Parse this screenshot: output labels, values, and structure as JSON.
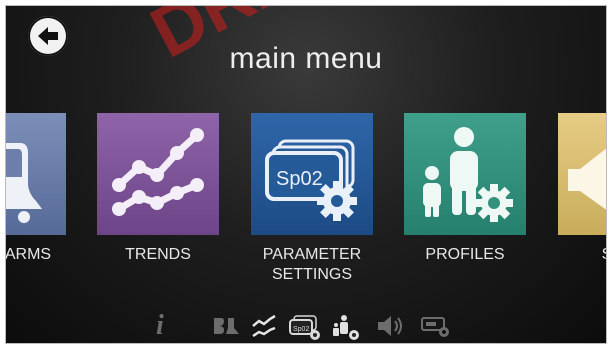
{
  "header": {
    "title": "main menu",
    "watermark": "DRAFT"
  },
  "tiles": [
    {
      "label": "ARMS",
      "icon": "alarm-bell-icon",
      "color": "#6c7fa9"
    },
    {
      "label": "TRENDS",
      "icon": "trends-graph-icon",
      "color": "#7e55a0"
    },
    {
      "label": "PARAMETER SETTINGS",
      "icon": "spo2-settings-icon",
      "color": "#255a99"
    },
    {
      "label": "PROFILES",
      "icon": "profiles-family-icon",
      "color": "#33917c"
    },
    {
      "label": "SOU",
      "icon": "speaker-icon",
      "color": "#d8bd70"
    }
  ],
  "bottom_bar": {
    "icons": [
      "info-icon",
      "alarm-silence-icon",
      "trends-icon",
      "parameter-settings-icon",
      "profiles-icon",
      "sound-icon",
      "device-settings-icon"
    ],
    "info_glyph": "i",
    "spo2_glyph": "Sp02"
  }
}
